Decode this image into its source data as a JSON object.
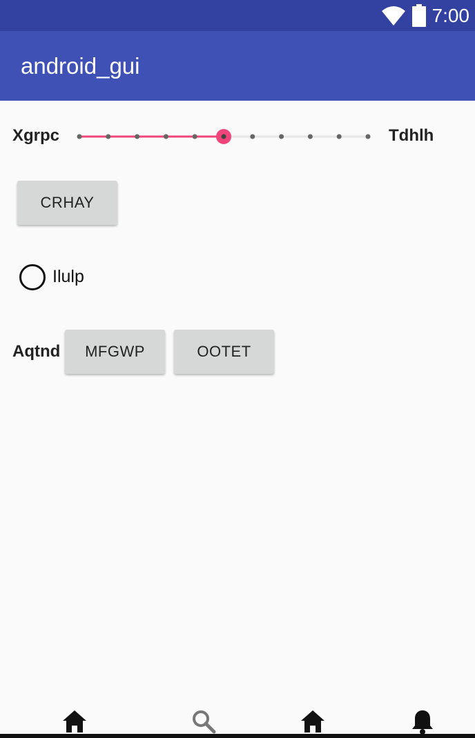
{
  "status_bar": {
    "time": "7:00",
    "icons": [
      "wifi-icon",
      "battery-icon"
    ]
  },
  "app_bar": {
    "title": "android_gui"
  },
  "seekbar": {
    "left_label": "Xgrpc",
    "right_label": "Tdhlh",
    "steps": 10,
    "value": 5,
    "accent": "#f0457a"
  },
  "crhay_button": {
    "label": "CRHAY"
  },
  "radio": {
    "label": "Ilulp",
    "checked": false
  },
  "button_row": {
    "label": "Aqtnd",
    "buttons": [
      "MFGWP",
      "OOTET"
    ]
  },
  "bottom_nav": {
    "items": [
      "home-icon",
      "search-icon",
      "home-icon",
      "bell-icon"
    ]
  },
  "colors": {
    "status_bar": "#3342a0",
    "app_bar": "#3f51b5",
    "background": "#fafafa",
    "button": "#d6d7d7"
  }
}
